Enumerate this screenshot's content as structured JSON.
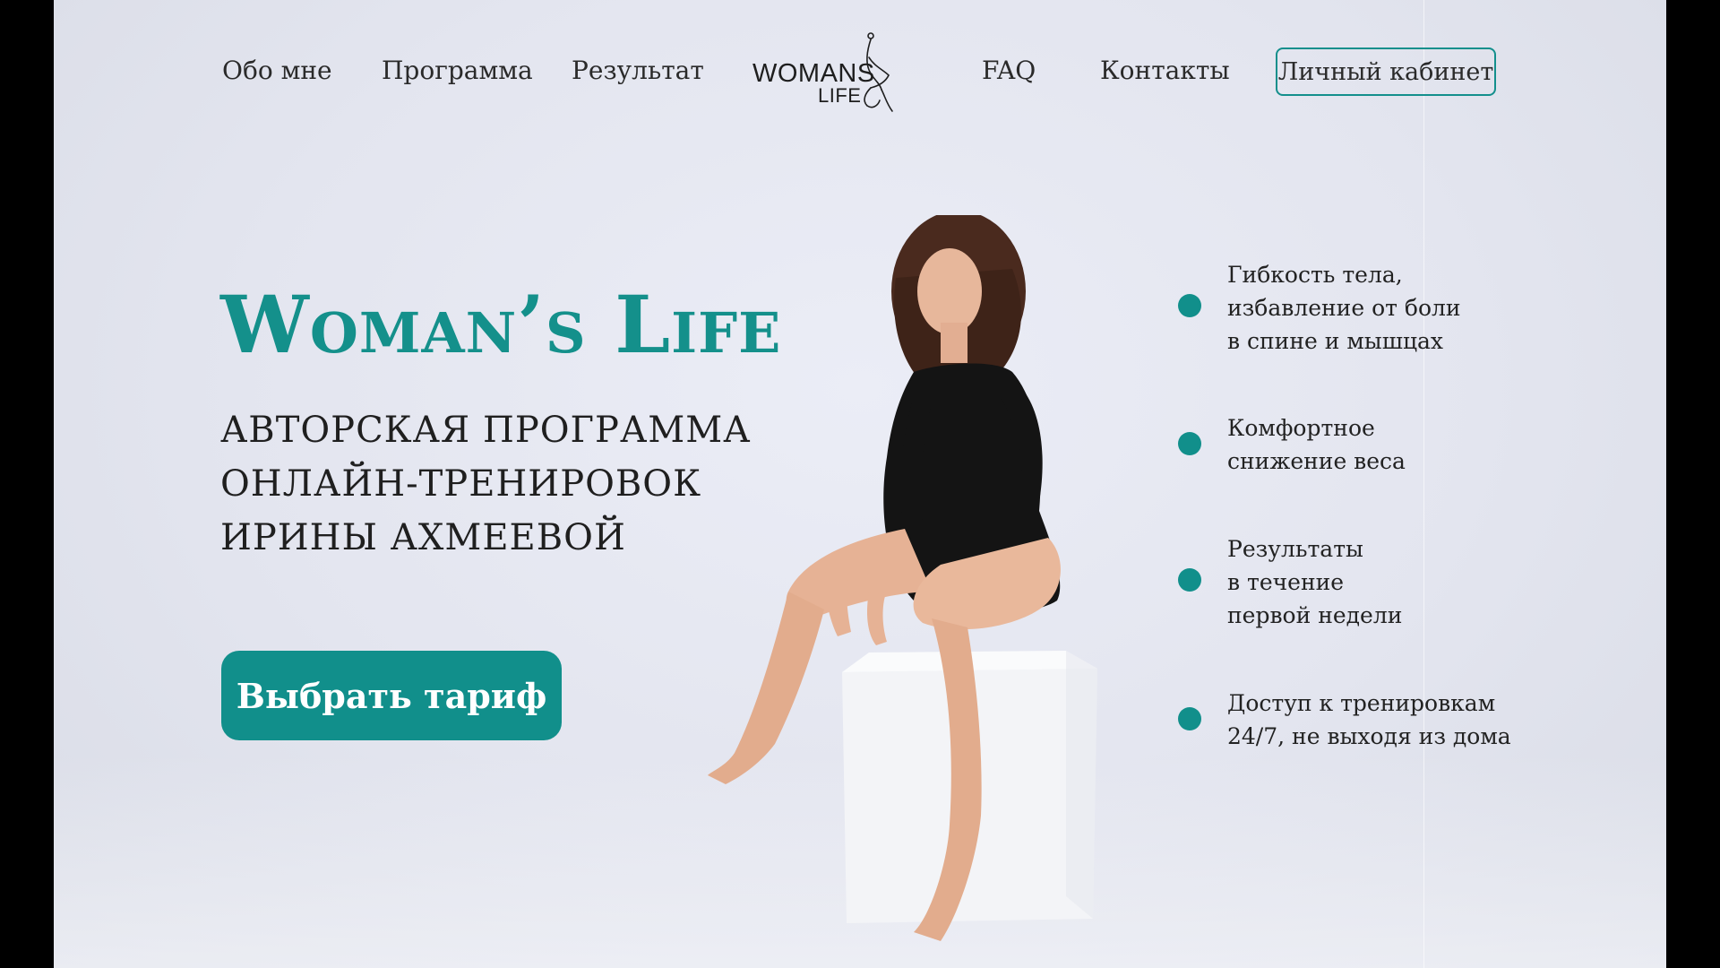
{
  "nav": {
    "about": "Обо мне",
    "program": "Программа",
    "result": "Результат",
    "faq": "FAQ",
    "contacts": "Контакты",
    "cabinet": "Личный кабинет",
    "logo_line1": "WOMANS",
    "logo_line2": "LIFE"
  },
  "hero": {
    "title": "Woman’s Life",
    "subtitle": [
      "АВТОРСКАЯ ПРОГРАММА",
      "ОНЛАЙН-ТРЕНИРОВОК",
      "ИРИНЫ АХМЕЕВОЙ"
    ],
    "cta": "Выбрать тариф"
  },
  "features": [
    {
      "lines": [
        "Гибкость тела,",
        "избавление от боли",
        "в спине и мышцах"
      ]
    },
    {
      "lines": [
        "Комфортное",
        "снижение веса"
      ]
    },
    {
      "lines": [
        "Результаты",
        "в течение",
        "первой недели"
      ]
    },
    {
      "lines": [
        "Доступ к тренировкам",
        "24/7, не выходя из дома"
      ]
    }
  ],
  "colors": {
    "accent": "#118f8b",
    "text": "#222222",
    "background": "#e6e8f1"
  }
}
